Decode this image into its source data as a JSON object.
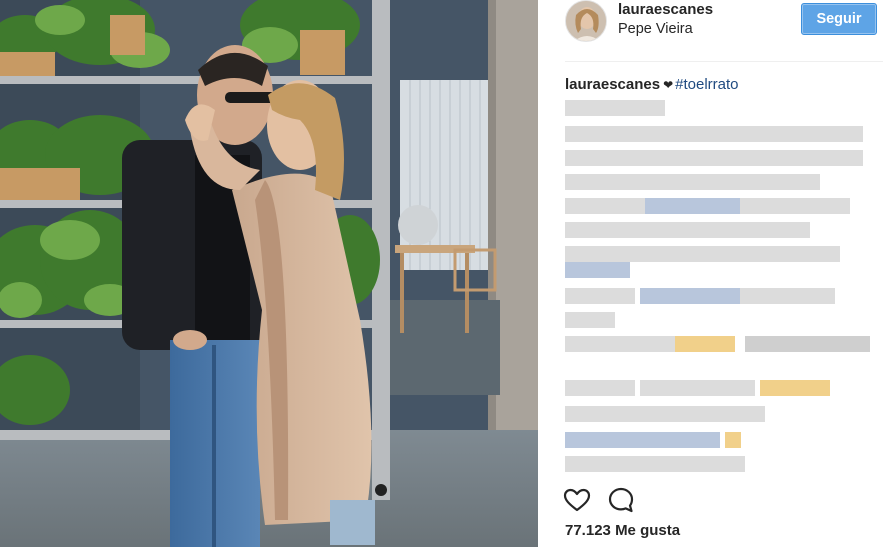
{
  "post": {
    "username": "lauraescanes",
    "location": "Pepe Vieira",
    "follow_label": "Seguir",
    "caption": {
      "username": "lauraescanes",
      "heart": "❤",
      "hashtag": "#toelrrato"
    },
    "likes_count": "77.123",
    "likes_label": "Me gusta"
  },
  "icons": {
    "like": "heart-outline-icon",
    "comment": "comment-bubble-icon"
  },
  "colors": {
    "follow_button": "#5ea4e6",
    "hashtag": "#1f4a80",
    "text": "#262626"
  }
}
